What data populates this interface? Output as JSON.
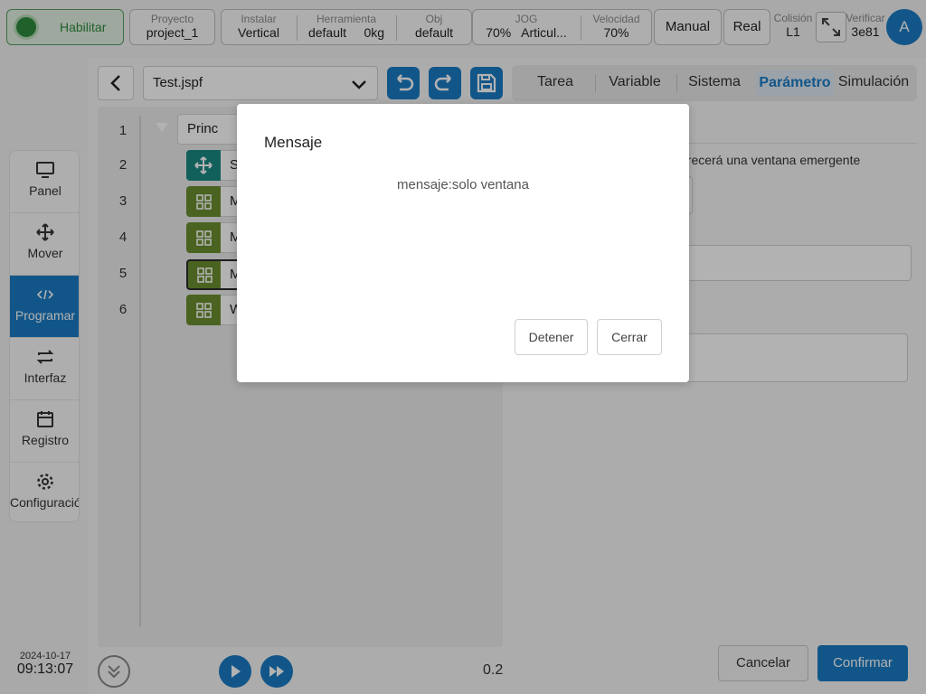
{
  "topbar": {
    "enable_label": "Habilitar",
    "project": {
      "label": "Proyecto",
      "value": "project_1"
    },
    "install": {
      "label": "Instalar",
      "value": "Vertical"
    },
    "tool": {
      "label": "Herramienta",
      "value_name": "default",
      "value_weight": "0kg"
    },
    "obj": {
      "label": "Obj",
      "value": "default"
    },
    "jog": {
      "label": "JOG",
      "value_pct": "70%",
      "value_mode": "Articul..."
    },
    "speed": {
      "label": "Velocidad",
      "value": "70%"
    },
    "manual_label": "Manual",
    "real_label": "Real",
    "collision": {
      "label": "Colisión",
      "value": "L1"
    },
    "verify": {
      "label": "Verificar",
      "value": "3e81"
    },
    "avatar_letter": "A"
  },
  "sidebar": {
    "items": [
      {
        "label": "Panel",
        "icon": "monitor-icon"
      },
      {
        "label": "Mover",
        "icon": "move-icon"
      },
      {
        "label": "Programar",
        "icon": "code-icon",
        "active": true
      },
      {
        "label": "Interfaz",
        "icon": "swap-icon"
      },
      {
        "label": "Registro",
        "icon": "calendar-icon"
      },
      {
        "label": "Configuración",
        "icon": "gear-icon"
      }
    ]
  },
  "datetime": {
    "date": "2024-10-17",
    "time": "09:13:07"
  },
  "editor": {
    "file": "Test.jspf",
    "tabs": [
      "Tarea",
      "Variable",
      "Sistema",
      "Parámetro",
      "Simulación"
    ],
    "active_tab": "Parámetro",
    "lines": [
      "1",
      "2",
      "3",
      "4",
      "5",
      "6"
    ],
    "nodes": [
      {
        "text": "Princ",
        "type": "root"
      },
      {
        "text": "S",
        "type": "move"
      },
      {
        "text": "M",
        "type": "block"
      },
      {
        "text": "M",
        "type": "block"
      },
      {
        "text": "M",
        "type": "block",
        "selected": true
      },
      {
        "text": "W",
        "type": "block"
      }
    ],
    "speed_value": "0.2",
    "param_hint": "arecerá una ventana emergente"
  },
  "footer": {
    "cancel": "Cancelar",
    "confirm": "Confirmar"
  },
  "modal": {
    "title": "Mensaje",
    "message": "mensaje:solo ventana",
    "stop": "Detener",
    "close": "Cerrar"
  },
  "colors": {
    "accent": "#1a7bc4",
    "green": "#6a8f2f",
    "teal": "#1b8a84"
  }
}
